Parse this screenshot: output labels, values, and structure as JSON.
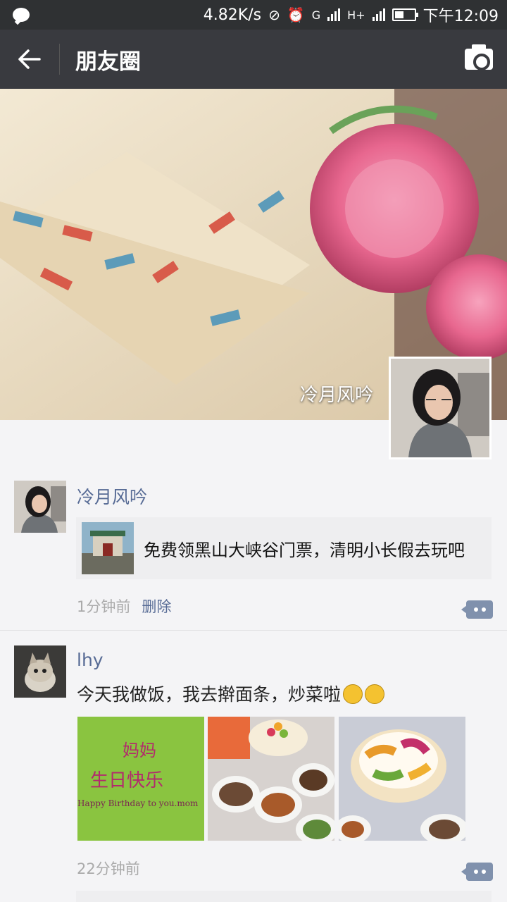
{
  "status_bar": {
    "network_speed": "4.82K/s",
    "net_g": "G",
    "net_h": "H+",
    "time": "下午12:09"
  },
  "nav": {
    "title": "朋友圈"
  },
  "cover": {
    "owner_name": "冷月风吟"
  },
  "posts": [
    {
      "user": "冷月风吟",
      "link_title": "免费领黑山大峡谷门票，清明小长假去玩吧",
      "time": "1分钟前",
      "delete_label": "删除"
    },
    {
      "user": "lhy",
      "text": "今天我做饭，我去擀面条，炒菜啦",
      "photo1_line1": "妈妈",
      "photo1_line2": "生日快乐",
      "photo1_line3": "Happy Birthday to you.mom",
      "time": "22分钟前"
    }
  ],
  "colors": {
    "status_bar": "#2f3133",
    "nav_bar": "#393a3f",
    "link_name": "#576b95",
    "background": "#f4f4f6"
  }
}
